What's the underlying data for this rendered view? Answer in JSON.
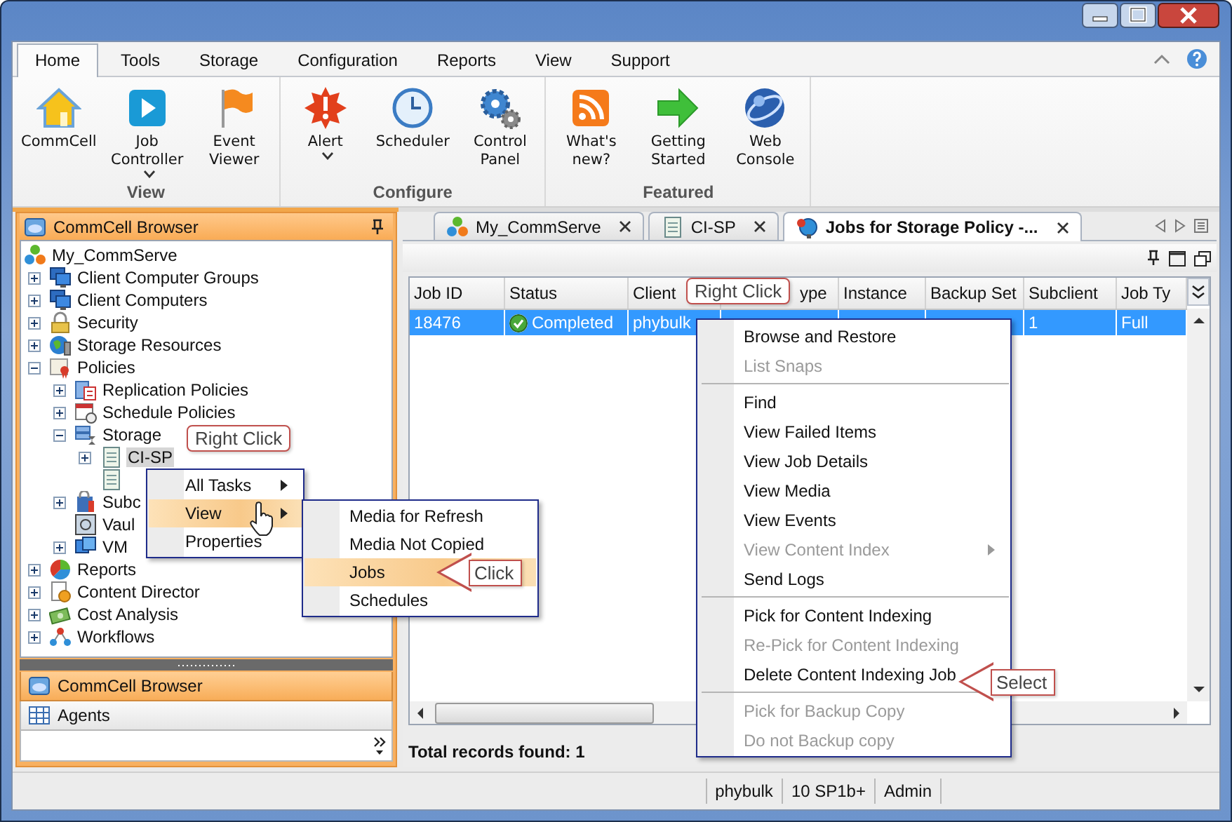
{
  "ribbon": {
    "tabs": [
      {
        "label": "Home",
        "selected": true
      },
      {
        "label": "Tools",
        "selected": false
      },
      {
        "label": "Storage",
        "selected": false
      },
      {
        "label": "Configuration",
        "selected": false
      },
      {
        "label": "Reports",
        "selected": false
      },
      {
        "label": "View",
        "selected": false
      },
      {
        "label": "Support",
        "selected": false
      }
    ],
    "groups": [
      {
        "label": "View",
        "buttons": [
          {
            "label": "CommCell",
            "kind": "house",
            "dropdown": false
          },
          {
            "label": "Job Controller",
            "kind": "play",
            "dropdown": true
          },
          {
            "label": "Event Viewer",
            "kind": "flag",
            "dropdown": false
          }
        ]
      },
      {
        "label": "Configure",
        "buttons": [
          {
            "label": "Alert",
            "kind": "alert",
            "dropdown": true
          },
          {
            "label": "Scheduler",
            "kind": "clock",
            "dropdown": false
          },
          {
            "label": "Control Panel",
            "kind": "gears",
            "dropdown": false
          }
        ]
      },
      {
        "label": "Featured",
        "buttons": [
          {
            "label": "What's new?",
            "kind": "rss",
            "dropdown": false
          },
          {
            "label": "Getting Started",
            "kind": "arrow",
            "dropdown": false
          },
          {
            "label": "Web Console",
            "kind": "globe",
            "dropdown": false
          }
        ]
      }
    ]
  },
  "browser": {
    "title": "CommCell Browser",
    "tree": [
      {
        "label": "My_CommServe",
        "kind": "balls",
        "selected": false,
        "children": [
          {
            "label": "Client Computer Groups",
            "kind": "computers",
            "selected": false,
            "expanded": false
          },
          {
            "label": "Client Computers",
            "kind": "computers",
            "selected": false,
            "expanded": false
          },
          {
            "label": "Security",
            "kind": "lock",
            "selected": false,
            "expanded": false
          },
          {
            "label": "Storage Resources",
            "kind": "globe",
            "selected": false,
            "expanded": false
          },
          {
            "label": "Policies",
            "kind": "certificate",
            "selected": false,
            "expanded": true,
            "children": [
              {
                "label": "Replication Policies",
                "kind": "replication",
                "selected": false,
                "expanded": false
              },
              {
                "label": "Schedule Policies",
                "kind": "calendar",
                "selected": false,
                "expanded": false
              },
              {
                "label": "Storage",
                "kind": "storage",
                "selected": false,
                "expanded": true,
                "children": [
                  {
                    "label": "CI-SP",
                    "kind": "document",
                    "selected": true,
                    "expanded": false
                  },
                  {
                    "kind": "document"
                  }
                ]
              },
              {
                "label": "Subc",
                "kind": "subclient",
                "selected": false,
                "expanded": false
              },
              {
                "label": "Vaul",
                "kind": "vault",
                "selected": false
              },
              {
                "label": "VM",
                "kind": "vm",
                "selected": false,
                "expanded": false
              }
            ]
          },
          {
            "label": "Reports",
            "kind": "pie",
            "selected": false,
            "expanded": false
          },
          {
            "label": "Content Director",
            "kind": "contentdir",
            "selected": false,
            "expanded": false
          },
          {
            "label": "Cost Analysis",
            "kind": "money",
            "selected": false,
            "expanded": false
          },
          {
            "label": "Workflows",
            "kind": "workflow",
            "selected": false,
            "expanded": false
          }
        ]
      }
    ],
    "nav": [
      {
        "label": "CommCell Browser",
        "kind": "browser",
        "selected": true
      },
      {
        "label": "Agents",
        "kind": "grid",
        "selected": false
      }
    ]
  },
  "tree_menu": {
    "items": [
      {
        "label": "All Tasks",
        "submenu": true,
        "selected": false
      },
      {
        "label": "View",
        "submenu": true,
        "selected": true
      },
      {
        "label": "Properties",
        "submenu": false,
        "selected": false
      }
    ],
    "submenu": [
      {
        "label": "Media for Refresh",
        "selected": false
      },
      {
        "label": "Media Not Copied",
        "selected": false
      },
      {
        "label": "Jobs",
        "selected": true
      },
      {
        "label": "Schedules",
        "selected": false
      }
    ]
  },
  "callouts": [
    {
      "text": "Right Click",
      "kind": "balloon"
    },
    {
      "text": "Click",
      "kind": "arrow"
    },
    {
      "text": "Right Click",
      "kind": "balloon"
    },
    {
      "text": "Select",
      "kind": "arrow"
    }
  ],
  "doc_tabs": [
    {
      "label": "My_CommServe",
      "kind": "balls",
      "selected": false
    },
    {
      "label": "CI-SP",
      "kind": "document",
      "selected": false
    },
    {
      "label": "Jobs for Storage Policy -...",
      "kind": "jobs",
      "selected": true
    }
  ],
  "table": {
    "columns": [
      "Job ID",
      "Status",
      "Client",
      "ype",
      "Instance",
      "Backup Set",
      "Subclient",
      "Job Ty"
    ],
    "rows": [
      {
        "cells": [
          "18476",
          "Completed",
          "phybulk",
          null,
          null,
          null,
          "1",
          "Full"
        ],
        "selected": true
      }
    ]
  },
  "total": "Total records found: 1",
  "job_menu": [
    {
      "kind": "item",
      "label": "Browse and Restore",
      "disabled": false
    },
    {
      "kind": "item",
      "label": "List Snaps",
      "disabled": true
    },
    {
      "kind": "separator"
    },
    {
      "kind": "item",
      "label": "Find",
      "disabled": false
    },
    {
      "kind": "item",
      "label": "View Failed Items",
      "disabled": false
    },
    {
      "kind": "item",
      "label": "View Job Details",
      "disabled": false
    },
    {
      "kind": "item",
      "label": "View Media",
      "disabled": false
    },
    {
      "kind": "item",
      "label": "View Events",
      "disabled": false
    },
    {
      "kind": "item",
      "label": "View Content Index",
      "disabled": true,
      "submenu": true
    },
    {
      "kind": "item",
      "label": "Send Logs",
      "disabled": false
    },
    {
      "kind": "separator"
    },
    {
      "kind": "item",
      "label": "Pick for Content Indexing",
      "disabled": false
    },
    {
      "kind": "item",
      "label": "Re-Pick for Content Indexing",
      "disabled": true
    },
    {
      "kind": "item",
      "label": "Delete Content Indexing Job",
      "disabled": false
    },
    {
      "kind": "separator"
    },
    {
      "kind": "item",
      "label": "Pick for Backup Copy",
      "disabled": true
    },
    {
      "kind": "item",
      "label": "Do not Backup copy",
      "disabled": true
    }
  ],
  "status_bar": [
    "phybulk",
    "10 SP1b+",
    "Admin"
  ]
}
